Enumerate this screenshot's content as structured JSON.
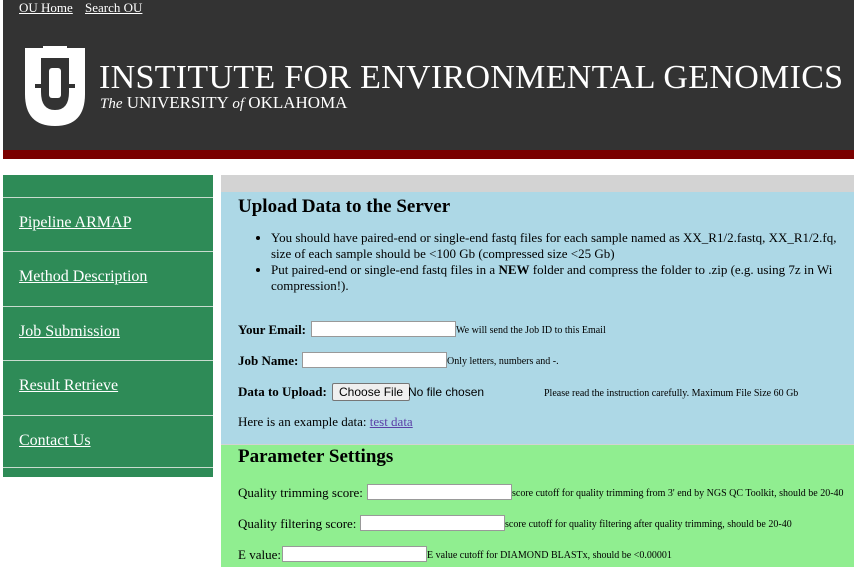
{
  "top_links": {
    "home": "OU Home",
    "search": "Search OU"
  },
  "header": {
    "title": "INSTITUTE FOR ENVIRONMENTAL GENOMICS",
    "subtitle_the": "The",
    "subtitle_university": "UNIVERSITY",
    "subtitle_of": "of",
    "subtitle_state": "OKLAHOMA"
  },
  "sidebar": {
    "items": [
      {
        "label": "Pipeline ARMAP"
      },
      {
        "label": "Method Description"
      },
      {
        "label": "Job Submission"
      },
      {
        "label": "Result Retrieve"
      },
      {
        "label": "Contact Us"
      }
    ]
  },
  "upload": {
    "heading": "Upload Data to the Server",
    "bullet1_line1": "You should have paired-end or single-end fastq files for each sample named as XX_R1/2.fastq, XX_R1/2.fq,",
    "bullet1_line2": "size of each sample should be <100 Gb (compressed size <25 Gb)",
    "bullet2_pre": "Put paired-end or single-end fastq files in a",
    "bullet2_bold": "NEW",
    "bullet2_post": "folder and compress the folder to .zip (e.g. using 7z in Wi",
    "bullet2_line2": "compression!).",
    "email_label": "Your Email:",
    "email_hint": "We will send the Job ID to this Email",
    "jobname_label": "Job Name:",
    "jobname_hint": "Only letters, numbers and -.",
    "data_label": "Data to Upload:",
    "choose_file": "Choose File",
    "no_file": "No file chosen",
    "data_hint": "Please read the instruction carefully. Maximum File Size 60 Gb",
    "example_text": "Here is an example data:",
    "example_link": "test data"
  },
  "params": {
    "heading": "Parameter Settings",
    "trim_label": "Quality trimming score:",
    "trim_hint": "score cutoff for quality trimming from 3' end by NGS QC Toolkit, should be 20-40",
    "filter_label": "Quality filtering score:",
    "filter_hint": "score cutoff for quality filtering after quality trimming, should be 20-40",
    "evalue_label": "E value:",
    "evalue_hint": "E value cutoff for DIAMOND BLASTx, should be <0.00001"
  }
}
